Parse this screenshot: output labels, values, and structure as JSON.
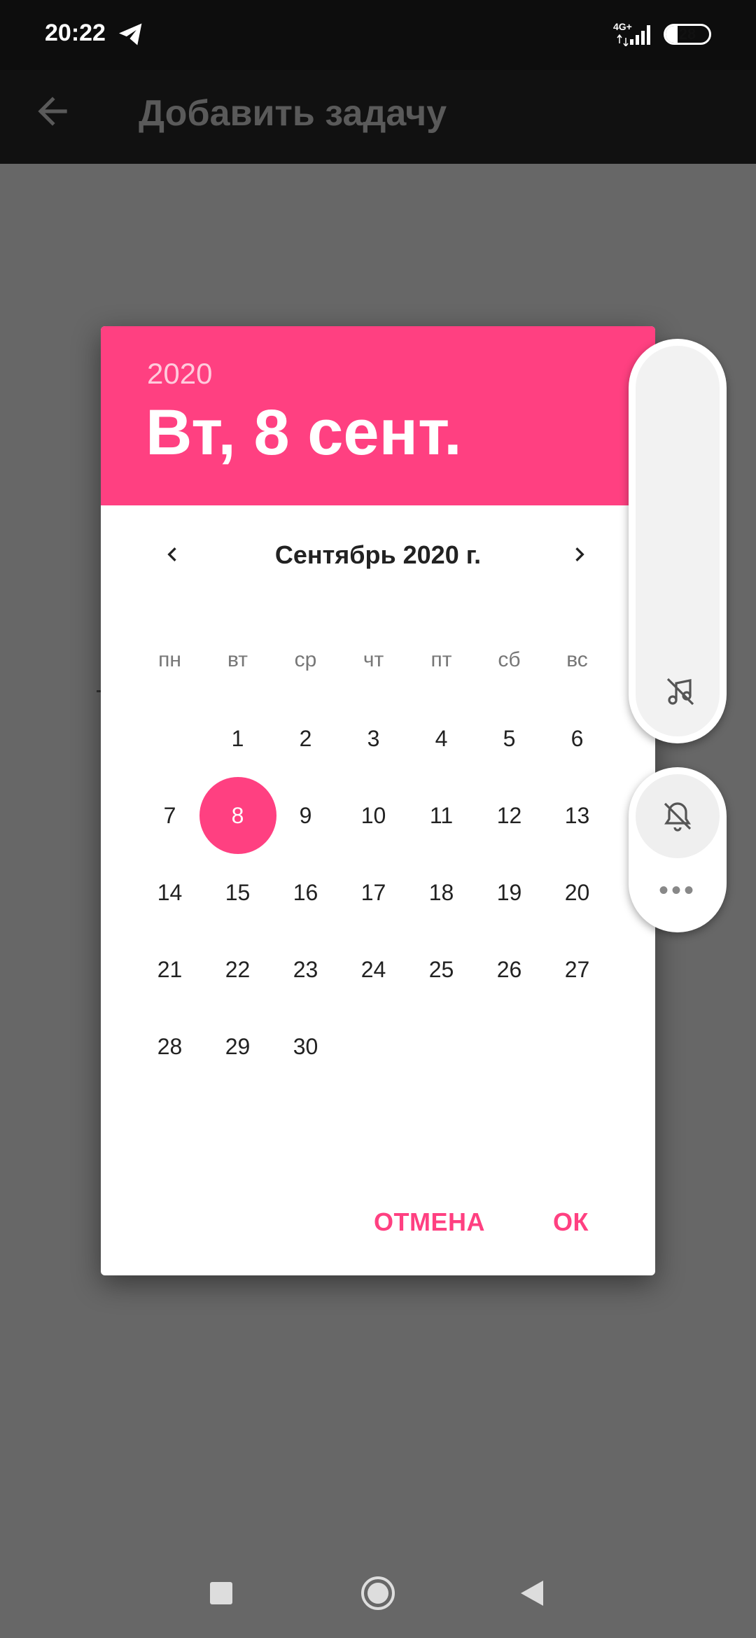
{
  "status_bar": {
    "time": "20:22",
    "network": "4G+",
    "battery": "28",
    "battery_level": 0.28
  },
  "app_bar": {
    "title": "Добавить задачу"
  },
  "date_picker": {
    "year": "2020",
    "selected_date_label": "Вт, 8 сент.",
    "month_title": "Сентябрь 2020 г.",
    "weekdays": [
      "пн",
      "вт",
      "ср",
      "чт",
      "пт",
      "сб",
      "вс"
    ],
    "days": [
      "1",
      "2",
      "3",
      "4",
      "5",
      "6",
      "7",
      "8",
      "9",
      "10",
      "11",
      "12",
      "13",
      "14",
      "15",
      "16",
      "17",
      "18",
      "19",
      "20",
      "21",
      "22",
      "23",
      "24",
      "25",
      "26",
      "27",
      "28",
      "29",
      "30"
    ],
    "selected_day": "8",
    "cancel_label": "ОТМЕНА",
    "ok_label": "ОК"
  },
  "side_panel": {
    "more_label": "•••"
  },
  "colors": {
    "accent": "#ff4081",
    "scrim": "#676767",
    "app_bar": "#111111"
  },
  "icons": [
    "telegram-icon",
    "signal-icon",
    "battery-icon",
    "back-arrow-icon",
    "chevron-left-icon",
    "chevron-right-icon",
    "music-off-icon",
    "bell-off-icon",
    "more-icon",
    "nav-recents-icon",
    "nav-home-icon",
    "nav-back-icon"
  ]
}
